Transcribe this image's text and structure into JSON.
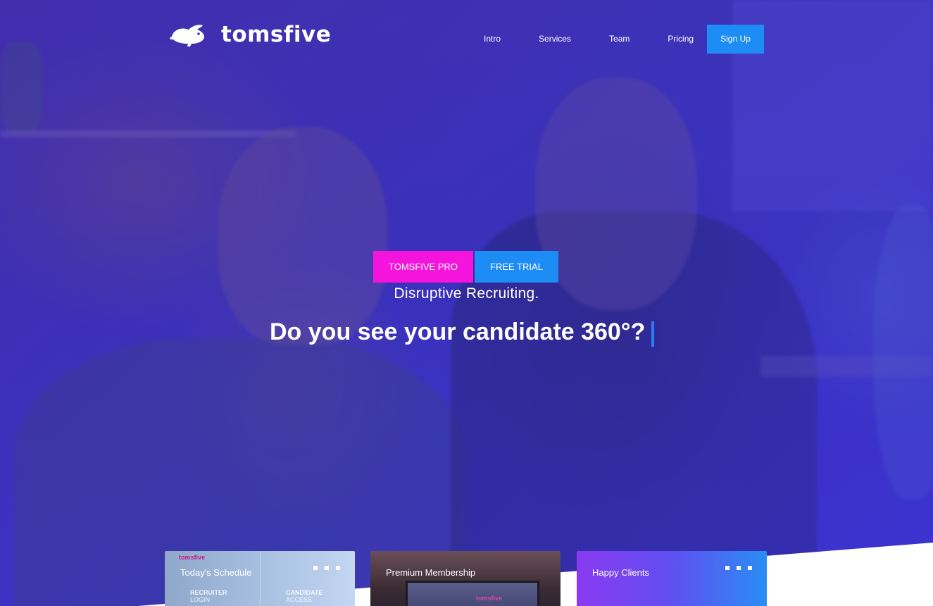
{
  "brand": {
    "name": "tomsfive",
    "logo_icon": "rabbit-logo-icon"
  },
  "nav": {
    "items": [
      {
        "label": "Intro"
      },
      {
        "label": "Services"
      },
      {
        "label": "Team"
      },
      {
        "label": "Pricing"
      }
    ],
    "signup_label": "Sign Up"
  },
  "hero": {
    "buttons": {
      "pro_label": "TOMSFIVE PRO",
      "trial_label": "FREE TRIAL"
    },
    "subtitle": "Disruptive Recruiting.",
    "headline": "Do you see your candidate 360°?"
  },
  "cards": [
    {
      "title": "Today's Schedule",
      "brand": "tomsfive",
      "left_label": "RECRUITER",
      "left_sub": "LOGIN",
      "right_label": "CANDIDATE",
      "right_sub": "ACCESS"
    },
    {
      "title": "Premium Membership",
      "brand": "tomsfive"
    },
    {
      "title": "Happy Clients"
    }
  ],
  "colors": {
    "accent_blue": "#1e8cf5",
    "accent_pink": "#f414dc",
    "hero_overlay": "#3a2fb8"
  }
}
